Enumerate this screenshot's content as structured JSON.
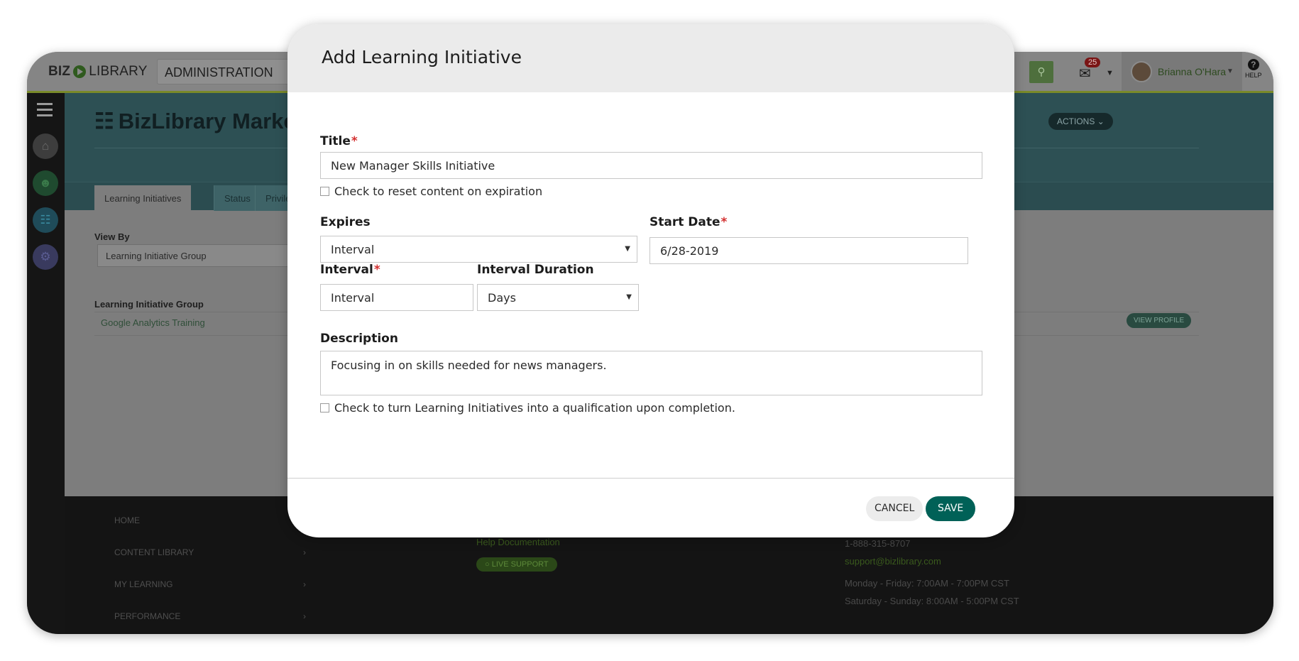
{
  "topbar": {
    "logo_biz": "BIZ",
    "logo_library": "LIBRARY",
    "admin_select": "ADMINISTRATION",
    "mail_badge": "25",
    "user_name": "Brianna O'Hara",
    "help_label": "HELP"
  },
  "page": {
    "title": "BizLibrary Marke",
    "actions_label": "ACTIONS",
    "tabs": [
      {
        "label": "Learning Initiatives"
      },
      {
        "label": "Status"
      },
      {
        "label": "Privileg"
      }
    ],
    "view_by_label": "View By",
    "view_by_value": "Learning Initiative Group",
    "group_header": "Learning Initiative Group",
    "group_row": "Google Analytics Training",
    "view_profile_label": "VIEW PROFILE"
  },
  "footer": {
    "nav": [
      {
        "label": "HOME"
      },
      {
        "label": "CONTENT LIBRARY"
      },
      {
        "label": "MY LEARNING"
      },
      {
        "label": "PERFORMANCE"
      }
    ],
    "help_doc": "Help Documentation",
    "live_support": "LIVE SUPPORT",
    "phone": "1-888-315-8707",
    "email": "support@bizlibrary.com",
    "hours_weekday": "Monday - Friday: 7:00AM - 7:00PM CST",
    "hours_weekend": "Saturday - Sunday: 8:00AM - 5:00PM CST"
  },
  "modal": {
    "title": "Add Learning Initiative",
    "title_label": "Title",
    "title_value": "New Manager Skills Initiative",
    "reset_checkbox_label": "Check to reset content on expiration",
    "expires_label": "Expires",
    "expires_value": "Interval",
    "start_date_label": "Start Date",
    "start_date_value": "6/28-2019",
    "interval_label": "Interval",
    "interval_value": "Interval",
    "interval_duration_label": "Interval Duration",
    "interval_duration_value": "Days",
    "description_label": "Description",
    "description_value": "Focusing in on skills needed for news managers.",
    "qualification_checkbox_label": "Check to turn Learning Initiatives into a qualification upon completion.",
    "cancel_label": "CANCEL",
    "save_label": "SAVE",
    "required_mark": "*"
  },
  "colors": {
    "save_button": "#006157",
    "required": "#d32f2f"
  },
  "icons": [
    "search-icon",
    "mail-icon",
    "help-icon",
    "hamburger-icon",
    "home-icon",
    "users-icon",
    "library-icon",
    "gear-icon",
    "books-icon",
    "chat-icon",
    "chevron-right-icon"
  ]
}
